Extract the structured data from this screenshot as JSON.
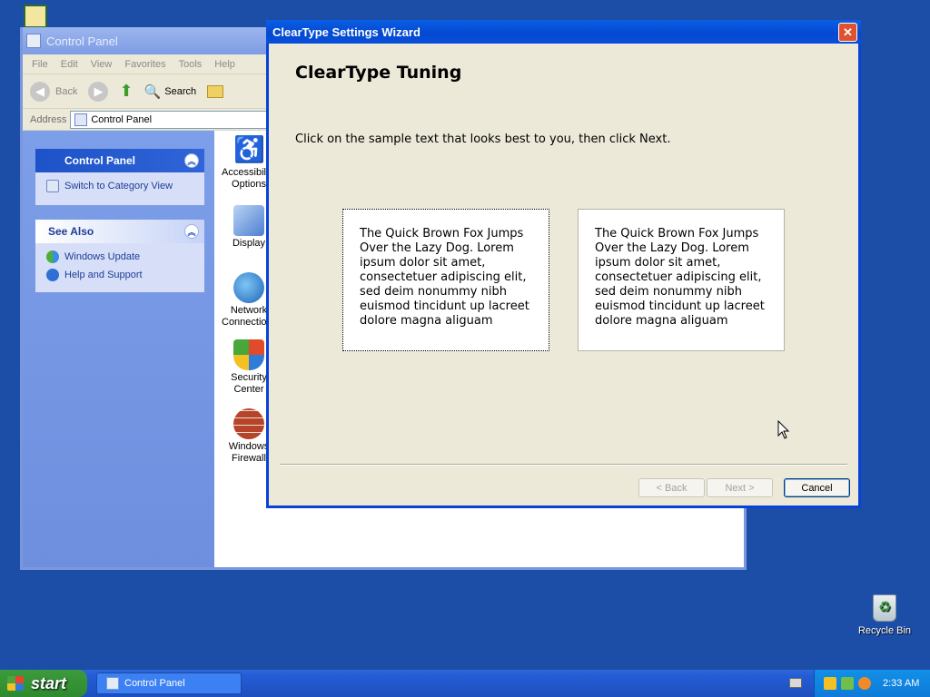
{
  "desktop": {
    "recycle_bin": "Recycle Bin"
  },
  "control_panel": {
    "title": "Control Panel",
    "menu": [
      "File",
      "Edit",
      "View",
      "Favorites",
      "Tools",
      "Help"
    ],
    "toolbar": {
      "back": "Back",
      "search": "Search"
    },
    "address": {
      "label": "Address",
      "value": "Control Panel"
    },
    "taskpane": {
      "panel_title": "Control Panel",
      "switch_view": "Switch to Category View",
      "see_also_title": "See Also",
      "see_also": [
        "Windows Update",
        "Help and Support"
      ]
    },
    "items": [
      {
        "label": "Accessibility Options",
        "icon": "accessibility-icon"
      },
      {
        "label": "Display",
        "icon": "display-icon"
      },
      {
        "label": "Network Connections",
        "icon": "network-icon"
      },
      {
        "label": "Security Center",
        "icon": "security-shield-icon"
      },
      {
        "label": "Windows Firewall",
        "icon": "firewall-icon"
      }
    ]
  },
  "wizard": {
    "title": "ClearType Settings Wizard",
    "heading": "ClearType Tuning",
    "instruction": "Click on the sample text that looks best to you, then click Next.",
    "samples": [
      "The Quick Brown Fox Jumps Over the Lazy Dog. Lorem ipsum dolor sit amet, consectetuer adipiscing elit, sed deim nonummy nibh euismod tincidunt up lacreet dolore magna aliguam",
      "The Quick Brown Fox Jumps Over the Lazy Dog. Lorem ipsum dolor sit amet, consectetuer adipiscing elit, sed deim nonummy nibh euismod tincidunt up lacreet dolore magna aliguam"
    ],
    "buttons": {
      "back": "< Back",
      "next": "Next >",
      "cancel": "Cancel"
    }
  },
  "taskbar": {
    "start": "start",
    "task": "Control Panel",
    "clock": "2:33 AM"
  }
}
